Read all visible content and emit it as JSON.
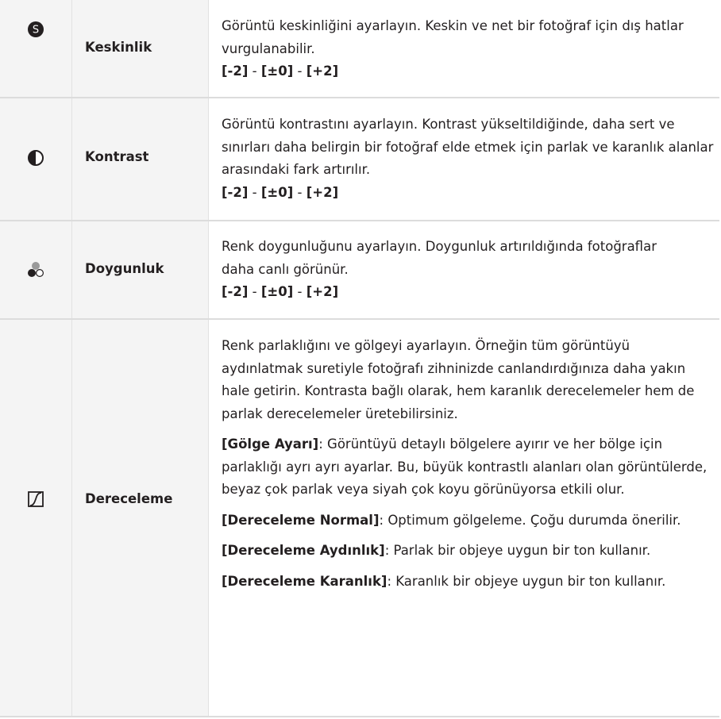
{
  "rows": [
    {
      "icon": "sharpness-icon",
      "label": "Keskinlik",
      "desc": "Görüntü keskinliğini ayarlayın. Keskin ve net bir fotoğraf için dış hatlar vurgulanabilir.",
      "range": [
        "[-2]",
        " - ",
        "[±0]",
        " - ",
        "[+2]"
      ]
    },
    {
      "icon": "contrast-icon",
      "label": "Kontrast",
      "desc": "Görüntü kontrastını ayarlayın. Kontrast yükseltildiğinde, daha sert ve sınırları daha belirgin bir fotoğraf elde etmek için parlak ve karanlık alanlar arasındaki fark artırılır.",
      "range": [
        "[-2]",
        " - ",
        "[±0]",
        " - ",
        "[+2]"
      ]
    },
    {
      "icon": "saturation-icon",
      "label": "Doygunluk",
      "desc": "Renk doygunluğunu ayarlayın. Doygunluk artırıldığında fotoğraflar daha canlı görünür.",
      "range": [
        "[-2]",
        " - ",
        "[±0]",
        " - ",
        "[+2]"
      ]
    },
    {
      "icon": "gradation-icon",
      "label": "Dereceleme",
      "desc": "Renk parlaklığını ve gölgeyi ayarlayın. Örneğin tüm görüntüyü aydınlatmak suretiyle fotoğrafı zihninizde canlandırdığınıza daha yakın hale getirin. Kontrasta bağlı olarak, hem karanlık derecelemeler hem de parlak derecelemeler üretebilirsiniz.",
      "options": [
        {
          "name": "[Gölge Ayarı]",
          "text": ": Görüntüyü detaylı bölgelere ayırır ve her bölge için parlaklığı ayrı ayrı ayarlar. Bu, büyük kontrastlı alanları olan görüntülerde, beyaz çok parlak veya siyah çok koyu görünüyorsa etkili olur."
        },
        {
          "name": "[Dereceleme Normal]",
          "text": ": Optimum gölgeleme. Çoğu durumda önerilir."
        },
        {
          "name": "[Dereceleme Aydınlık]",
          "text": ": Parlak bir objeye uygun bir ton kullanır."
        },
        {
          "name": "[Dereceleme Karanlık]",
          "text": ": Karanlık bir objeye uygun bir ton kullanır."
        }
      ]
    }
  ]
}
